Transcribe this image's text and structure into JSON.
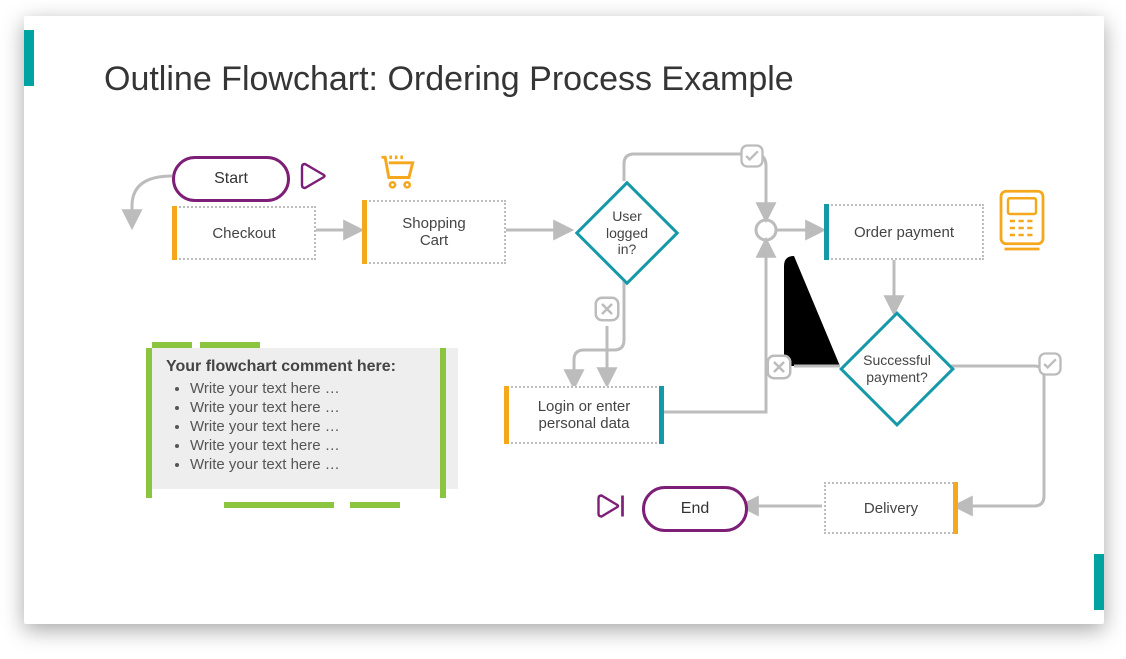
{
  "title": "Outline Flowchart: Ordering Process Example",
  "nodes": {
    "start": "Start",
    "checkout": "Checkout",
    "shopping_cart": "Shopping\nCart",
    "user_logged": "User\nlogged\nin?",
    "login_enter": "Login or enter\npersonal data",
    "order_payment": "Order payment",
    "successful_payment": "Successful\npayment?",
    "delivery": "Delivery",
    "end": "End"
  },
  "comment": {
    "header": "Your flowchart comment here:",
    "items": [
      "Write your text here …",
      "Write your text here …",
      "Write your text here …",
      "Write your text here …",
      "Write your text here …"
    ]
  },
  "colors": {
    "orange": "#f6a81c",
    "teal": "#1598a8",
    "purple": "#7e1f77",
    "green": "#8bc53f",
    "gray": "#bcbcbc"
  },
  "chart_data": {
    "type": "diagram",
    "flow": [
      {
        "id": "start",
        "shape": "terminator",
        "label": "Start"
      },
      {
        "id": "checkout",
        "shape": "process",
        "label": "Checkout"
      },
      {
        "id": "shopping_cart",
        "shape": "process",
        "label": "Shopping Cart"
      },
      {
        "id": "user_logged",
        "shape": "decision",
        "label": "User logged in?"
      },
      {
        "id": "login_enter",
        "shape": "process",
        "label": "Login or enter personal data"
      },
      {
        "id": "order_payment",
        "shape": "process",
        "label": "Order payment"
      },
      {
        "id": "successful_payment",
        "shape": "decision",
        "label": "Successful payment?"
      },
      {
        "id": "delivery",
        "shape": "process",
        "label": "Delivery"
      },
      {
        "id": "end",
        "shape": "terminator",
        "label": "End"
      }
    ],
    "edges": [
      {
        "from": "start",
        "to": "checkout"
      },
      {
        "from": "checkout",
        "to": "shopping_cart"
      },
      {
        "from": "shopping_cart",
        "to": "user_logged"
      },
      {
        "from": "user_logged",
        "to": "order_payment",
        "label": "yes"
      },
      {
        "from": "user_logged",
        "to": "login_enter",
        "label": "no"
      },
      {
        "from": "login_enter",
        "to": "order_payment"
      },
      {
        "from": "order_payment",
        "to": "successful_payment"
      },
      {
        "from": "successful_payment",
        "to": "delivery",
        "label": "yes"
      },
      {
        "from": "successful_payment",
        "to": "order_payment",
        "label": "no"
      },
      {
        "from": "delivery",
        "to": "end"
      }
    ]
  }
}
